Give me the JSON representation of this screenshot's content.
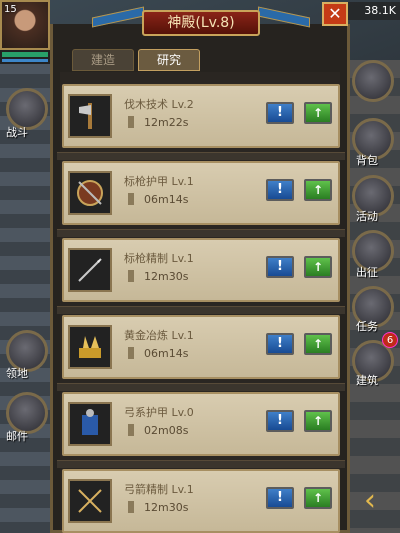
{
  "title": "神殿(Lv.8)",
  "close_label": "✕",
  "tabs": [
    "建造",
    "研究"
  ],
  "active_tab": "研究",
  "player_level": "15",
  "resource": "38.1K",
  "side_labels": {
    "left": [
      "战斗",
      "领地",
      "邮件"
    ],
    "right": [
      "背包",
      "活动",
      "出征",
      "任务",
      "建筑"
    ]
  },
  "red_badge": "6",
  "back_arrow": "‹",
  "research": [
    {
      "name": "伐木技术 Lv.2",
      "time": "12m22s",
      "icon": "axe-icon",
      "info": "!",
      "up": "↑"
    },
    {
      "name": "标枪护甲 Lv.1",
      "time": "06m14s",
      "icon": "shield-icon",
      "info": "!",
      "up": "↑"
    },
    {
      "name": "标枪精制 Lv.1",
      "time": "12m30s",
      "icon": "spear-icon",
      "info": "!",
      "up": "↑"
    },
    {
      "name": "黄金冶炼 Lv.1",
      "time": "06m14s",
      "icon": "gold-icon",
      "info": "!",
      "up": "↑"
    },
    {
      "name": "弓系护甲 Lv.0",
      "time": "02m08s",
      "icon": "armor-icon",
      "info": "!",
      "up": "↑"
    },
    {
      "name": "弓箭精制 Lv.1",
      "time": "12m30s",
      "icon": "arrows-icon",
      "info": "!",
      "up": "↑"
    }
  ]
}
